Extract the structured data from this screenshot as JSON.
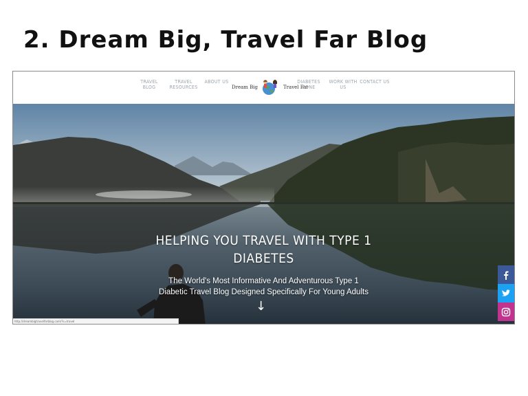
{
  "slide": {
    "title": "2. Dream Big, Travel Far Blog"
  },
  "nav": {
    "items": [
      {
        "label": "Travel Blog"
      },
      {
        "label": "Travel Resources"
      },
      {
        "label": "About Us"
      },
      {
        "label": "Diabetes Zone"
      },
      {
        "label": "Work With Us"
      },
      {
        "label": "Contact Us"
      }
    ],
    "logo": {
      "left_text": "Dream Big",
      "right_text": "Travel Far"
    }
  },
  "hero": {
    "title_line1": "Helping You Travel With Type 1",
    "title_line2": "Diabetes",
    "subtitle_line1": "The World's Most Informative And Adventurous Type 1",
    "subtitle_line2": "Diabetic Travel Blog Designed Specifically For Young Adults",
    "arrow": "↓"
  },
  "social": [
    {
      "icon": "facebook-icon",
      "color": "#3b5998"
    },
    {
      "icon": "twitter-icon",
      "color": "#1da1f2"
    },
    {
      "icon": "instagram-icon",
      "color": "#c1338f"
    }
  ],
  "statusbar": {
    "text": "http://dreambigtravelfarblog.com/?s=travel"
  }
}
